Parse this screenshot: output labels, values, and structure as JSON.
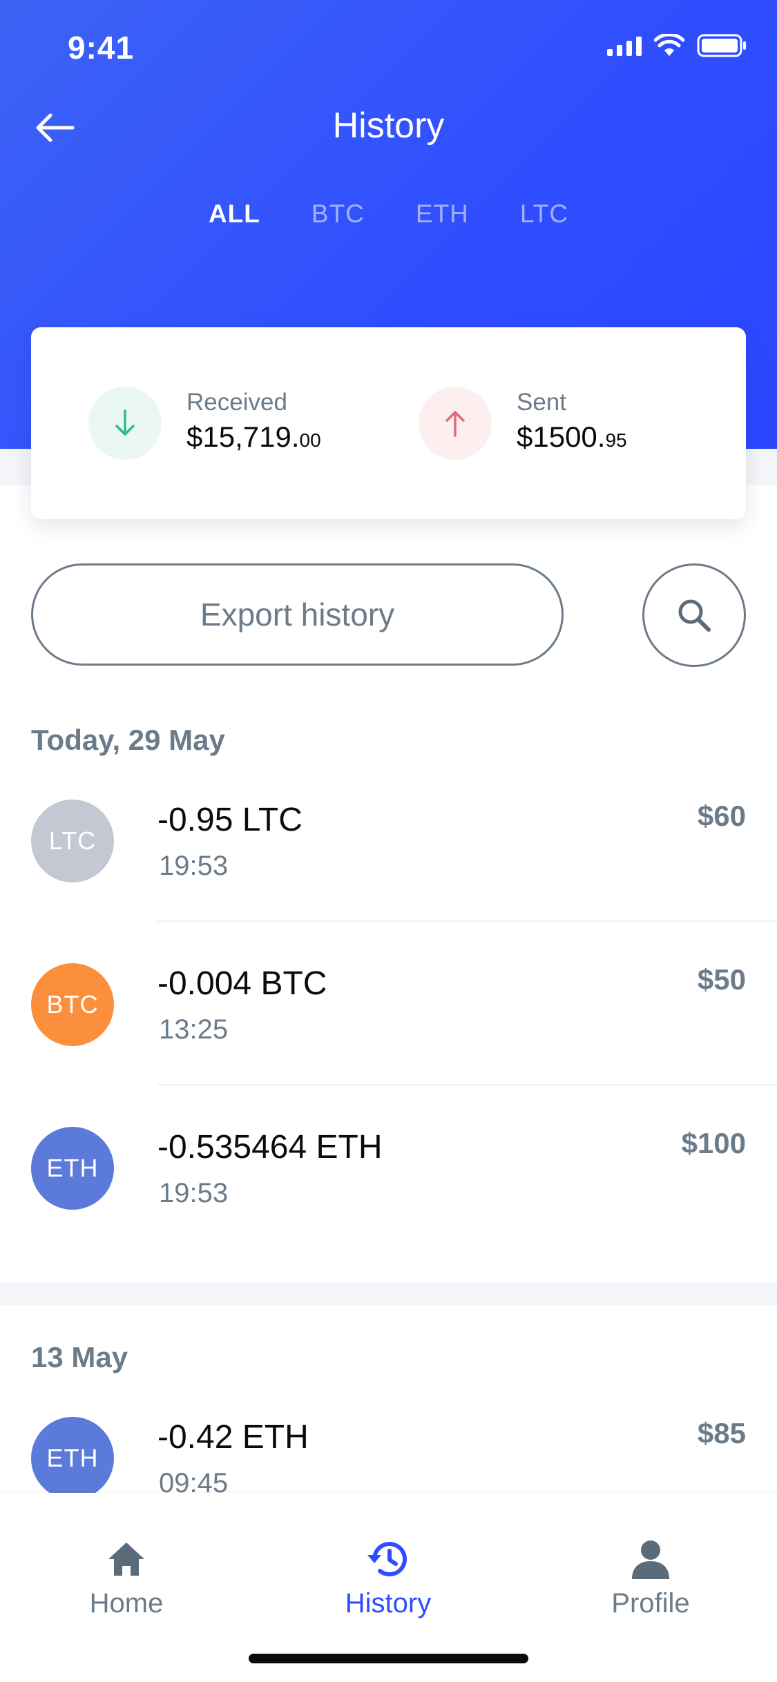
{
  "status_bar": {
    "time": "9:41"
  },
  "header": {
    "title": "History",
    "tabs": [
      {
        "label": "ALL",
        "active": true
      },
      {
        "label": "BTC",
        "active": false
      },
      {
        "label": "ETH",
        "active": false
      },
      {
        "label": "LTC",
        "active": false
      }
    ]
  },
  "summary": {
    "received": {
      "label": "Received",
      "amount_main": "$15,719.",
      "amount_cents": "00",
      "color": "#2fb98b"
    },
    "sent": {
      "label": "Sent",
      "amount_main": "$1500.",
      "amount_cents": "95",
      "color": "#e06a78"
    }
  },
  "actions": {
    "export_label": "Export history"
  },
  "sections": [
    {
      "date": "Today, 29 May",
      "transactions": [
        {
          "coin": "LTC",
          "amount": "-0.95 LTC",
          "time": "19:53",
          "value": "$60",
          "color": "#c3c8d3"
        },
        {
          "coin": "BTC",
          "amount": "-0.004 BTC",
          "time": "13:25",
          "value": "$50",
          "color": "#fb8f3c"
        },
        {
          "coin": "ETH",
          "amount": "-0.535464 ETH",
          "time": "19:53",
          "value": "$100",
          "color": "#5c7ad9"
        }
      ]
    },
    {
      "date": "13 May",
      "transactions": [
        {
          "coin": "ETH",
          "amount": "-0.42 ETH",
          "time": "09:45",
          "value": "$85",
          "color": "#5c7ad9"
        }
      ]
    }
  ],
  "bottom_nav": [
    {
      "label": "Home",
      "icon": "home-icon",
      "active": false
    },
    {
      "label": "History",
      "icon": "history-icon",
      "active": true
    },
    {
      "label": "Profile",
      "icon": "profile-icon",
      "active": false
    }
  ],
  "colors": {
    "accent": "#2f4dff",
    "muted": "#6b7b8a"
  }
}
